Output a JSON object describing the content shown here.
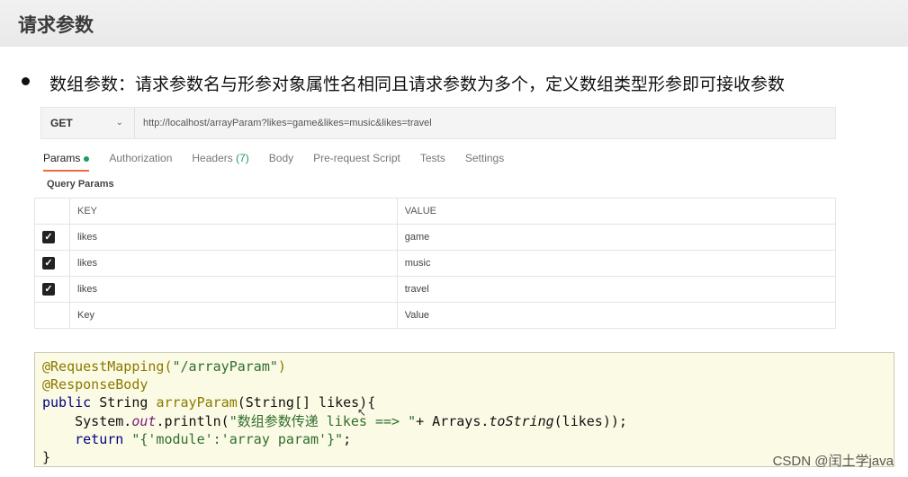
{
  "page": {
    "title": "请求参数",
    "bullet": "数组参数：请求参数名与形参对象属性名相同且请求参数为多个，定义数组类型形参即可接收参数"
  },
  "request": {
    "method": "GET",
    "url": "http://localhost/arrayParam?likes=game&likes=music&likes=travel"
  },
  "tabs": {
    "params": "Params",
    "authorization": "Authorization",
    "headers": "Headers",
    "headers_count": "(7)",
    "body": "Body",
    "prerequest": "Pre-request Script",
    "tests": "Tests",
    "settings": "Settings"
  },
  "query_params": {
    "label": "Query Params",
    "key_header": "KEY",
    "value_header": "VALUE",
    "rows": [
      {
        "key": "likes",
        "value": "game"
      },
      {
        "key": "likes",
        "value": "music"
      },
      {
        "key": "likes",
        "value": "travel"
      }
    ],
    "key_placeholder": "Key",
    "value_placeholder": "Value"
  },
  "code": {
    "l1_ann": "@RequestMapping(",
    "l1_str": "\"/arrayParam\"",
    "l1_end": ")",
    "l2_ann": "@ResponseBody",
    "l3_kw": "public",
    "l3_rest": " String ",
    "l3_method": "arrayParam",
    "l3_params": "(String[] likes){",
    "l4_a": "    System.",
    "l4_out": "out",
    "l4_b": ".println(",
    "l4_str": "\"数组参数传递 likes ==> \"",
    "l4_c": "+ Arrays.",
    "l4_to": "toString",
    "l4_d": "(likes));",
    "l5_kw": "    return",
    "l5_sp": " ",
    "l5_str": "\"{'module':'array param'}\"",
    "l5_end": ";",
    "l6": "}"
  },
  "watermark": "CSDN @闰土学java",
  "colors": {
    "accent_tab": "#f26b3a",
    "active_dot": "#1c9b5e",
    "code_bg": "#fbfae4"
  }
}
